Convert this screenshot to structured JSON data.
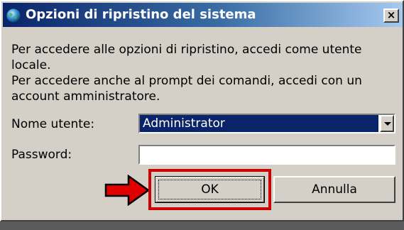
{
  "window": {
    "title": "Opzioni di ripristino del sistema",
    "close_glyph": "×",
    "icon": "globe-icon"
  },
  "messages": {
    "line1": "Per accedere alle opzioni di ripristino, accedi come utente locale.",
    "line2": "Per accedere anche al prompt dei comandi, accedi con un account amministratore."
  },
  "form": {
    "username_label": "Nome utente:",
    "username_value": "Administrator",
    "password_label": "Password:",
    "password_value": ""
  },
  "buttons": {
    "ok_label": "OK",
    "cancel_label": "Annulla"
  },
  "annotation": {
    "highlight_color": "#cc0000",
    "arrow_icon": "red-arrow-icon"
  },
  "colors": {
    "titlebar_start": "#0a246a",
    "titlebar_end": "#a6caf0",
    "selection": "#0a246a",
    "face": "#d4d0c8"
  }
}
